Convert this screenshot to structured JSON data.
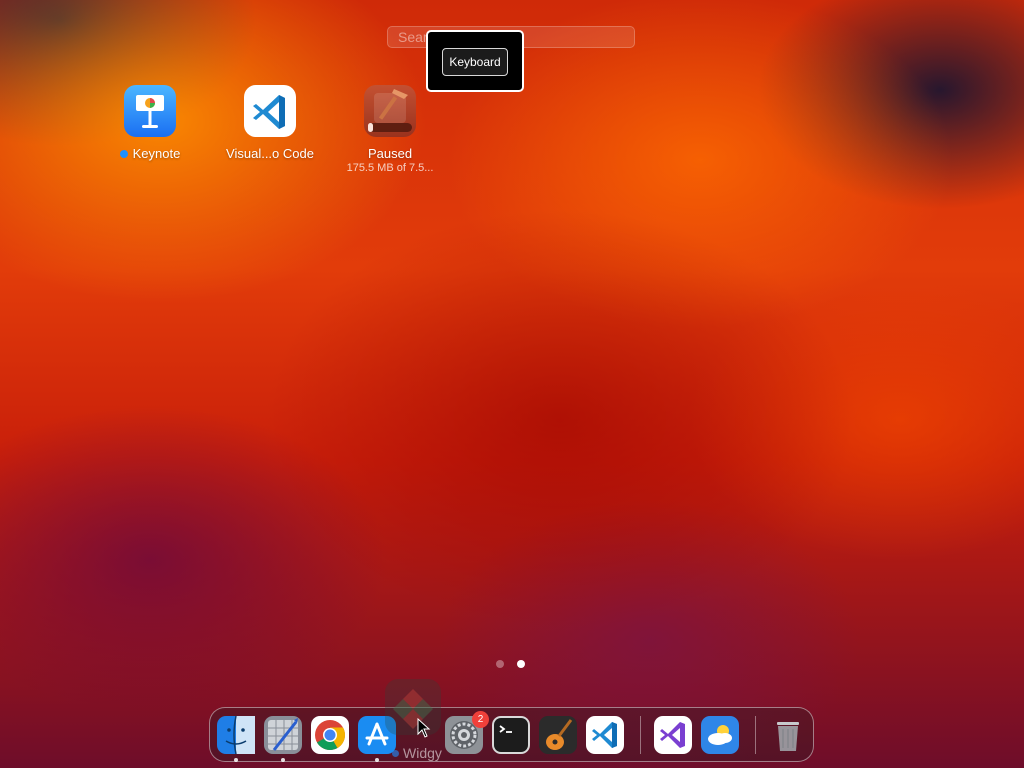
{
  "search": {
    "placeholder": "Search"
  },
  "keyboard_popup": {
    "button_label": "Keyboard"
  },
  "apps": {
    "keynote": {
      "label": "Keynote",
      "icon": "keynote-icon",
      "is_new": true
    },
    "vscode": {
      "label": "Visual...o Code",
      "icon": "vscode-icon"
    },
    "paused": {
      "label": "Paused",
      "subtitle": "175.5 MB of 7.5...",
      "icon": "xcode-download-icon",
      "progress": 0.03
    }
  },
  "page_dots": {
    "count": 2,
    "active_index": 1
  },
  "dock": {
    "items": [
      {
        "name": "Finder",
        "icon": "finder-icon",
        "running": true
      },
      {
        "name": "Xcode Instruments",
        "icon": "instruments-icon",
        "running": true
      },
      {
        "name": "Google Chrome",
        "icon": "chrome-icon",
        "running": false
      },
      {
        "name": "App Store",
        "icon": "app-store-icon",
        "running": true
      },
      {
        "name": "System Settings",
        "icon": "system-settings-icon",
        "running": false,
        "badge": "2"
      },
      {
        "name": "Terminal",
        "icon": "terminal-icon",
        "running": false
      },
      {
        "name": "GarageBand",
        "icon": "garageband-icon",
        "running": false
      },
      {
        "name": "Visual Studio Code",
        "icon": "vscode-icon",
        "running": false
      },
      {
        "name": "Visual Studio",
        "icon": "visual-studio-icon",
        "running": false
      },
      {
        "name": "Weather",
        "icon": "weather-icon",
        "running": false
      },
      {
        "name": "Trash",
        "icon": "trash-icon",
        "running": false
      }
    ]
  },
  "dragging": {
    "label": "Widgy",
    "icon": "widgy-icon"
  },
  "colors": {
    "accent_blue": "#1e90ff",
    "badge_red": "#f0403a",
    "keynote_blue": "#1a6ff2",
    "vscode_blue": "#1f8ad2"
  }
}
